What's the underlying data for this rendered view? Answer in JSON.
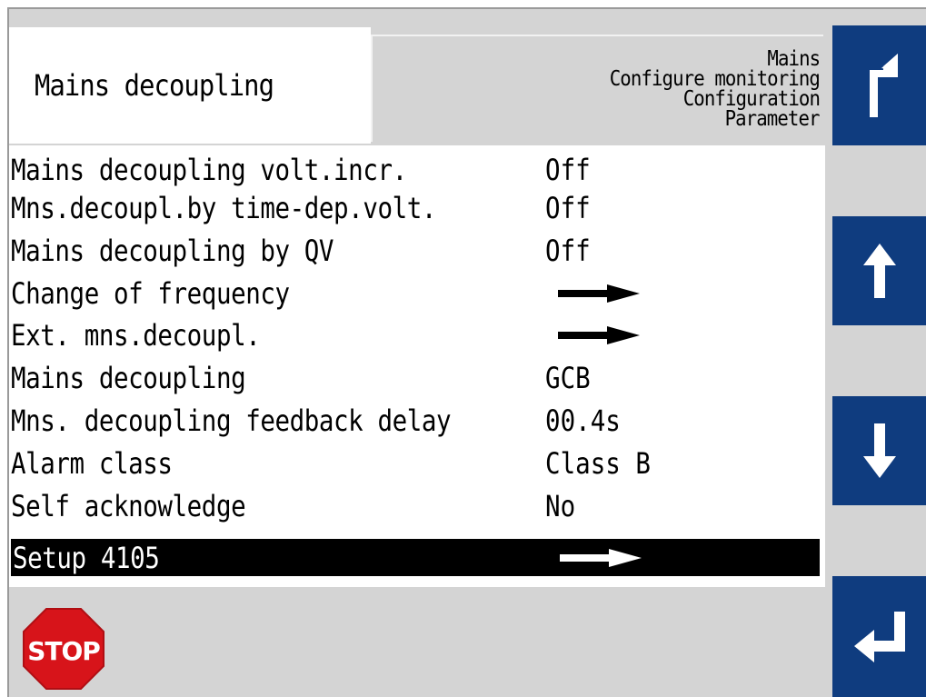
{
  "header": {
    "title": "Mains decoupling",
    "breadcrumb": [
      "Mains",
      "Configure monitoring",
      "Configuration",
      "Parameter"
    ]
  },
  "rows": [
    {
      "label": "Mains decoupling volt.incr.",
      "value": "Off",
      "arrow": false
    },
    {
      "label": "Mns.decoupl.by time-dep.volt.",
      "value": "Off",
      "arrow": false
    },
    {
      "label": "Mains decoupling by QV",
      "value": "Off",
      "arrow": false
    },
    {
      "label": "Change of frequency",
      "value": "",
      "arrow": true
    },
    {
      "label": "Ext. mns.decoupl.",
      "value": "",
      "arrow": true
    },
    {
      "label": "Mains decoupling",
      "value": "GCB",
      "arrow": false
    },
    {
      "label": "Mns. decoupling feedback delay",
      "value": "00.4s",
      "arrow": false
    },
    {
      "label": "Alarm class",
      "value": "Class B",
      "arrow": false
    },
    {
      "label": "Self acknowledge",
      "value": "No",
      "arrow": false
    },
    {
      "label": "Setup 4105",
      "value": "",
      "arrow": true,
      "selected": true
    }
  ],
  "stop_label": "STOP",
  "softkeys": {
    "return": {
      "icon": "return-arrow-icon"
    },
    "up": {
      "icon": "arrow-up-icon"
    },
    "down": {
      "icon": "arrow-down-icon"
    },
    "enter": {
      "icon": "enter-icon"
    }
  },
  "colors": {
    "softkey": "#0f3c7f",
    "panel": "#d4d4d4",
    "stop": "#d7141a",
    "selection": "#000000"
  }
}
